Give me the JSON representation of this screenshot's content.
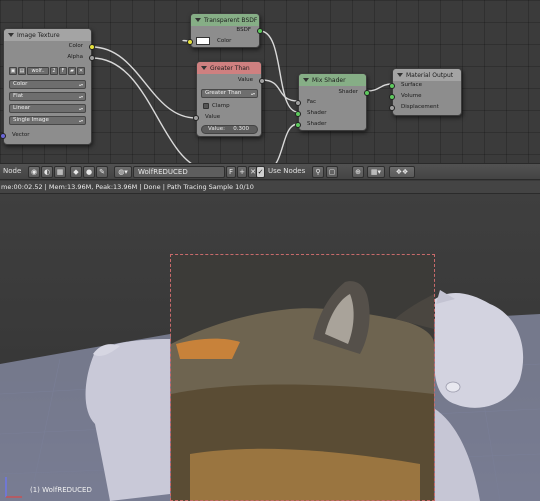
{
  "nodes": {
    "image_texture": {
      "title": "Image Texture",
      "outputs": [
        "Color",
        "Alpha"
      ],
      "image_name": "wolf..",
      "user_count": "2",
      "fake_user": "F",
      "color_space": "Color",
      "projection": "Flat",
      "interpolation": "Linear",
      "source": "Single Image",
      "inputs": [
        "Vector"
      ]
    },
    "transparent_bsdf": {
      "title": "Transparent BSDF",
      "output": "BSDF",
      "input": "Color",
      "color": "#ffffff"
    },
    "greater_than": {
      "title": "Greater Than",
      "output": "Value",
      "operation": "Greater Than",
      "clamp_label": "Clamp",
      "input": "Value",
      "value_label": "Value:",
      "value": "0.300"
    },
    "mix_shader": {
      "title": "Mix Shader",
      "output": "Shader",
      "inputs": [
        "Fac",
        "Shader",
        "Shader"
      ]
    },
    "material_output": {
      "title": "Material Output",
      "inputs": [
        "Surface",
        "Volume",
        "Displacement"
      ]
    }
  },
  "header": {
    "node_label": "Node",
    "material_name": "WolfREDUCED",
    "fake_user": "F",
    "use_nodes_label": "Use Nodes",
    "use_nodes_checked": true
  },
  "status": {
    "text": "me:00:02.52 | Mem:13.96M, Peak:13.96M | Done | Path Tracing Sample 10/10"
  },
  "viewport": {
    "object_label": "(1) WolfREDUCED"
  },
  "colors": {
    "socket_color": "#e6e23c",
    "socket_value": "#a0a0a0",
    "socket_shader": "#5ec95e",
    "socket_vector": "#6b66d6",
    "render_border": "#c86a6a"
  }
}
